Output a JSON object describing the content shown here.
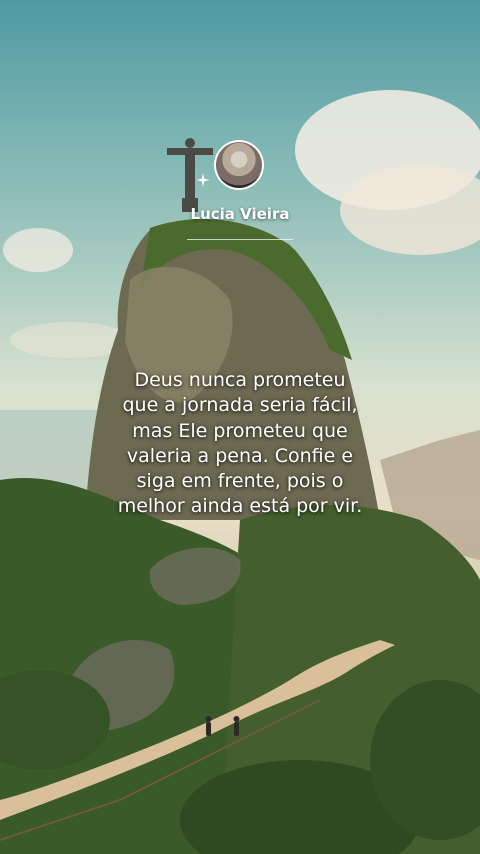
{
  "profile": {
    "name": "Lucia Vieira"
  },
  "quote": {
    "text": "Deus nunca prometeu\nque a jornada seria fácil,\nmas Ele prometeu que\nvaleria a pena. Confie e\nsiga em frente, pois o\nmelhor ainda está por vir."
  },
  "colors": {
    "text": "#ffffff",
    "sky_top": "#4f9aa2",
    "foliage": "#3f5f2c",
    "path": "#d9c09a"
  },
  "icons": {
    "sparkle": "sparkle-icon"
  }
}
